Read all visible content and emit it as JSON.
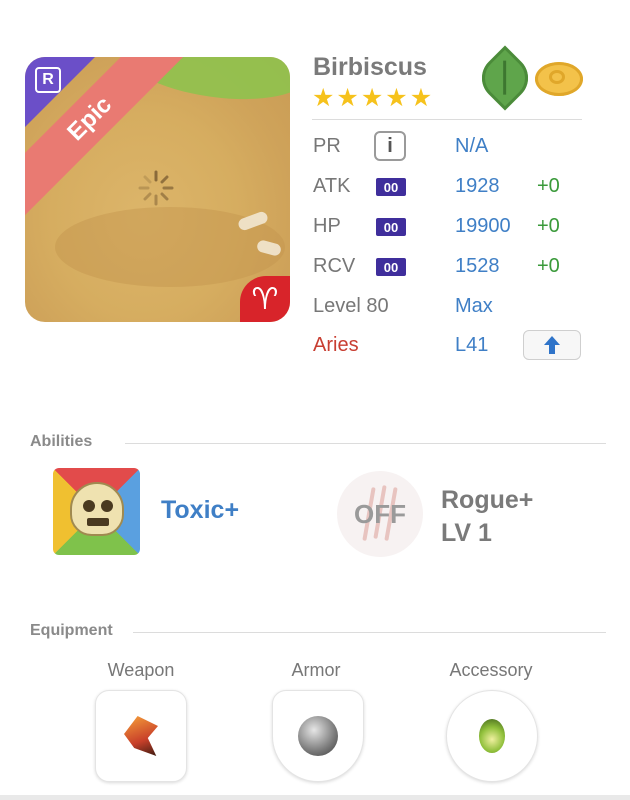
{
  "character": {
    "name": "Birbiscus",
    "stars": 5,
    "rarity_badge": "R",
    "rarity_label": "Epic",
    "sign_symbol": "♈",
    "elements": [
      "leaf-icon",
      "wind-icon"
    ]
  },
  "stats": {
    "pr": {
      "label": "PR",
      "value": "N/A",
      "button": "i"
    },
    "atk": {
      "label": "ATK",
      "badge": "00",
      "value": "1928",
      "plus": "+0"
    },
    "hp": {
      "label": "HP",
      "badge": "00",
      "value": "19900",
      "plus": "+0"
    },
    "rcv": {
      "label": "RCV",
      "badge": "00",
      "value": "1528",
      "plus": "+0"
    },
    "level": {
      "label": "Level 80",
      "value": "Max"
    },
    "sign": {
      "label": "Aries",
      "value": "L41"
    }
  },
  "sections": {
    "abilities": "Abilities",
    "equipment": "Equipment"
  },
  "abilities": [
    {
      "name": "Toxic+"
    },
    {
      "state": "OFF",
      "name_line1": "Rogue+",
      "name_line2": "LV 1"
    }
  ],
  "equipment": [
    {
      "label": "Weapon"
    },
    {
      "label": "Armor"
    },
    {
      "label": "Accessory"
    }
  ],
  "colors": {
    "accent_blue": "#3f7fc6",
    "plus_green": "#3a9a3a",
    "aries_red": "#c83e32",
    "star_yellow": "#f6c21c",
    "epic_ribbon": "#e97a72",
    "badge_purple": "#3f2e9c"
  }
}
